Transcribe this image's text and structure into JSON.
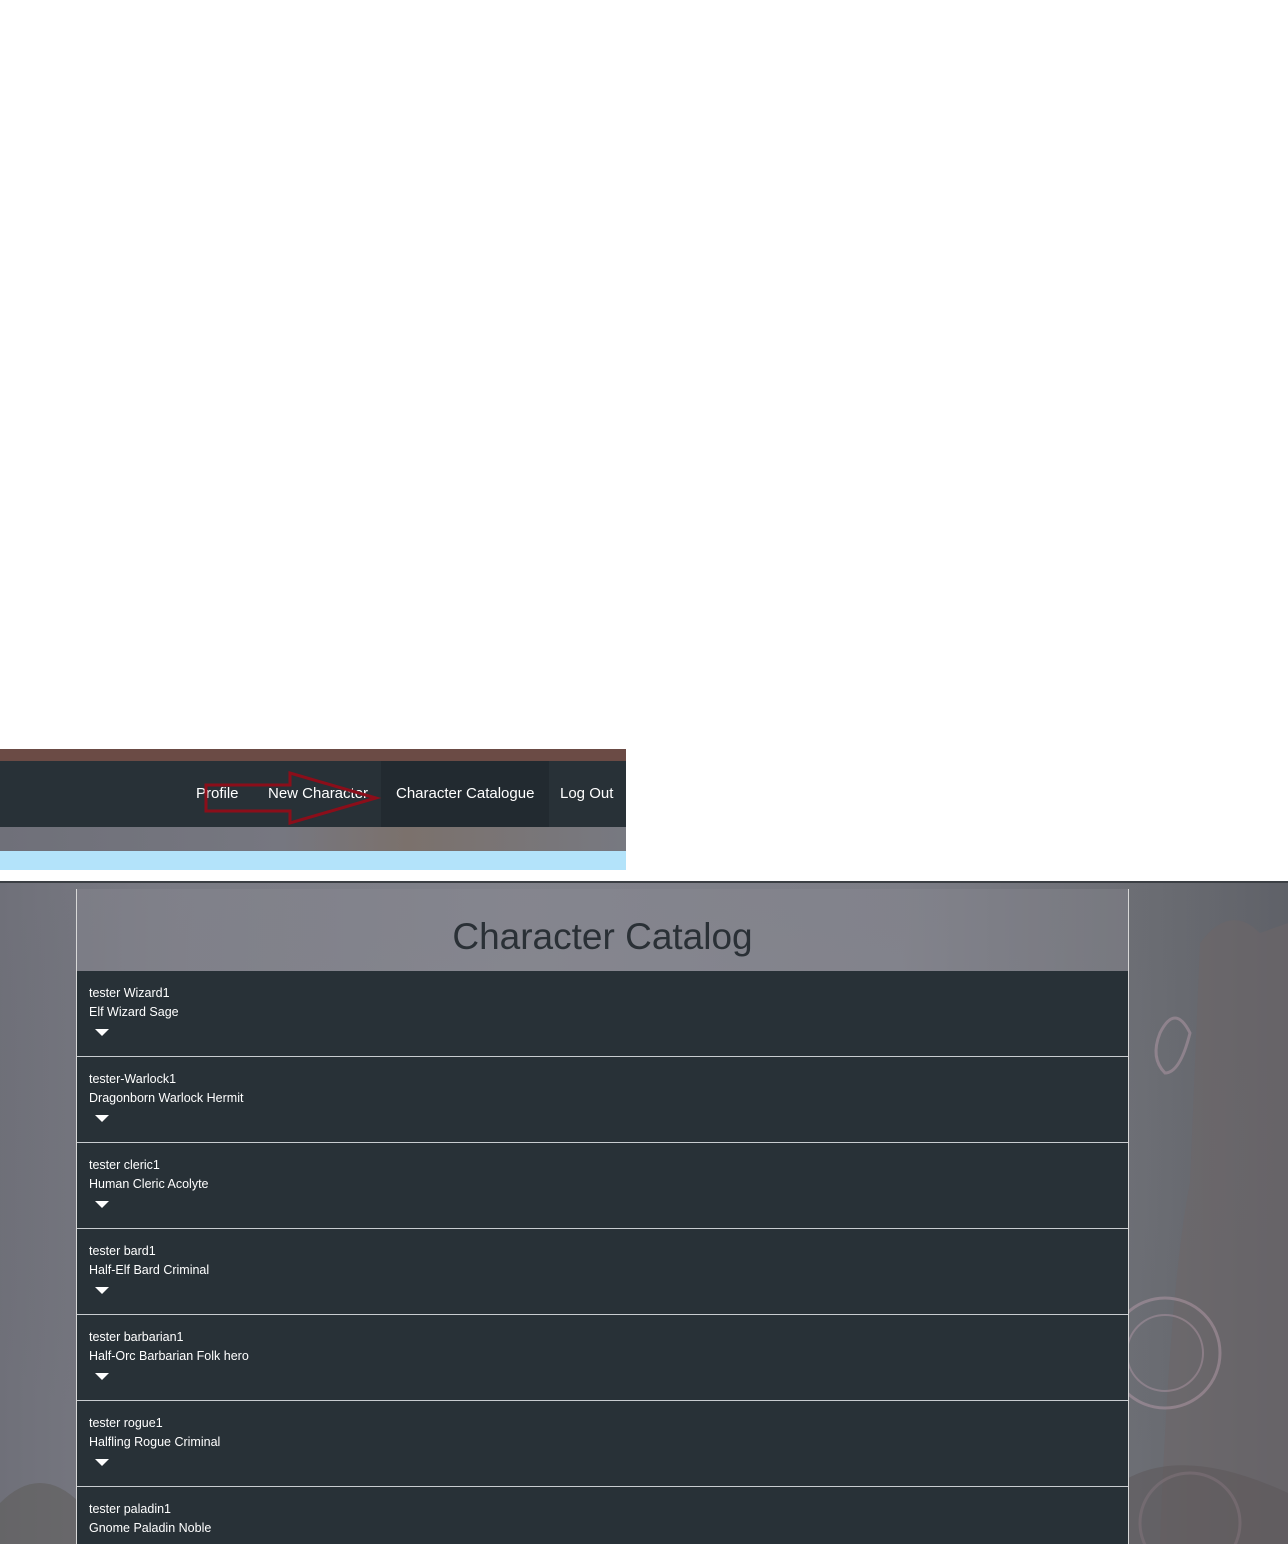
{
  "nav": {
    "links": [
      {
        "label": "Profile",
        "active": false
      },
      {
        "label": "New Character",
        "active": false
      },
      {
        "label": "Character Catalogue",
        "active": true
      },
      {
        "label": "Log Out",
        "active": false
      }
    ]
  },
  "annotation": {
    "icon": "arrow-right-icon",
    "color": "#8b0e1a"
  },
  "catalog": {
    "title": "Character Catalog",
    "characters": [
      {
        "name": "tester Wizard1",
        "description": "Elf Wizard Sage"
      },
      {
        "name": "tester-Warlock1",
        "description": "Dragonborn Warlock Hermit"
      },
      {
        "name": "tester cleric1",
        "description": "Human Cleric Acolyte"
      },
      {
        "name": "tester bard1",
        "description": "Half-Elf Bard Criminal"
      },
      {
        "name": "tester barbarian1",
        "description": "Half-Orc Barbarian Folk hero"
      },
      {
        "name": "tester rogue1",
        "description": "Halfling Rogue Criminal"
      },
      {
        "name": "tester paladin1",
        "description": "Gnome Paladin Noble"
      }
    ]
  },
  "colors": {
    "navbar": "#283137",
    "accent_brown": "#6b4b45",
    "light_blue": "#b3e3fa",
    "list_item_bg": "#283137"
  }
}
